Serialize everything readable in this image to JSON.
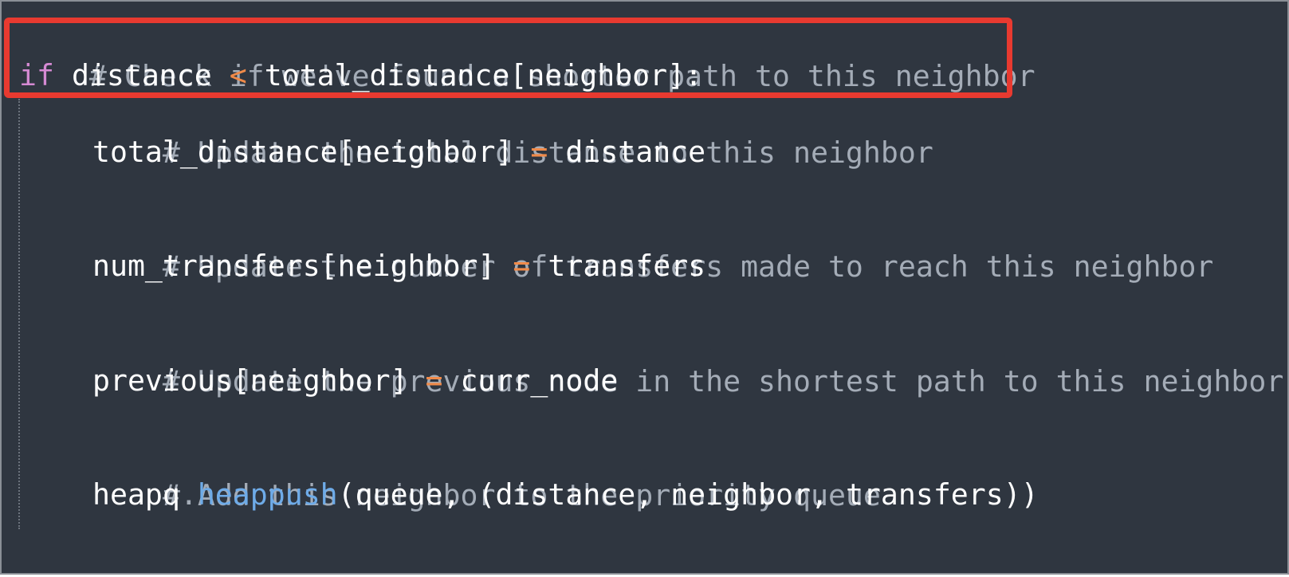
{
  "code": {
    "line1": {
      "comment": "# Check if we've found a shorter path to this neighbor"
    },
    "line2": {
      "keyword": "if",
      "a": "distance",
      "op": "<",
      "b": "total_distance[neighbor]",
      "colon": ":"
    },
    "line3": {
      "comment": "# Update the total distance to this neighbor"
    },
    "line4": {
      "a": "total_distance[neighbor]",
      "op": "=",
      "b": "distance"
    },
    "line5": {
      "comment": "# Update the number of transfers made to reach this neighbor"
    },
    "line6": {
      "a": "num_transfers[neighbor]",
      "op": "=",
      "b": "transfers"
    },
    "line7": {
      "comment": "# Update the previous node in the shortest path to this neighbor"
    },
    "line8": {
      "a": "previous[neighbor]",
      "op": "=",
      "b": "curr_node"
    },
    "line9": {
      "comment": "# Add this neighbor to the priority queue"
    },
    "line10": {
      "obj": "heapq",
      "dot": ".",
      "func": "heappush",
      "open": "(queue, (distance, neighbor, transfers))"
    }
  },
  "colors": {
    "background": "#2f3640",
    "comment": "#a4acb7",
    "keyword": "#d58ad3",
    "operator": "#f08a49",
    "function": "#6eabe8",
    "highlight_border": "#e83a30"
  }
}
